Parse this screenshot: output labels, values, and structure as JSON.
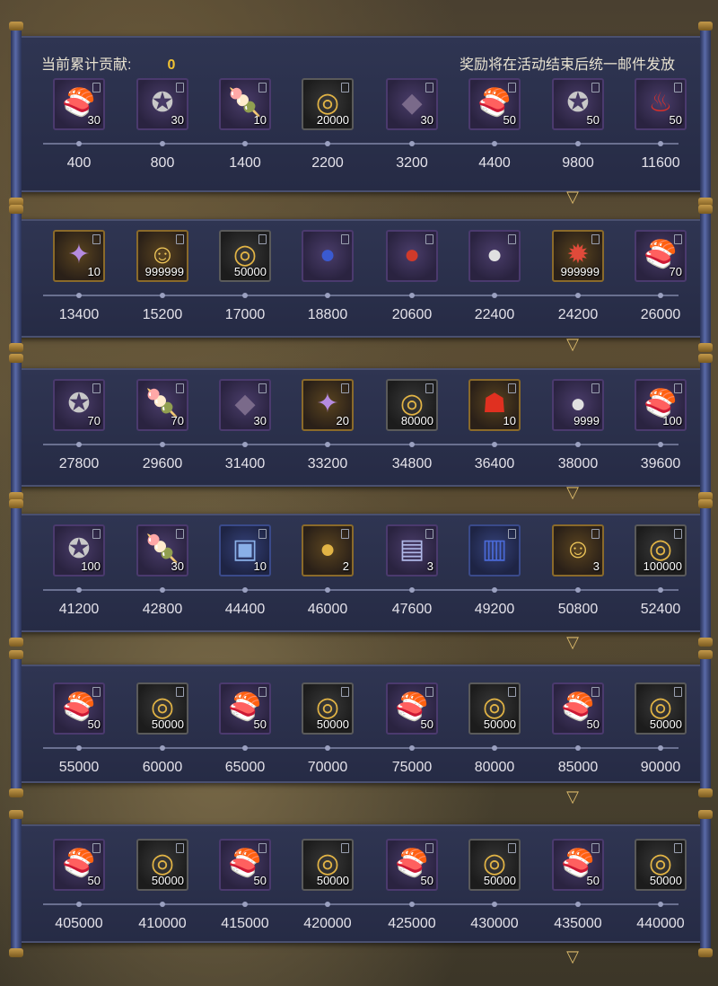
{
  "header": {
    "contribution_label": "当前累计贡献:",
    "contribution_value": "0",
    "mail_notice": "奖励将在活动结束后统一邮件发放"
  },
  "tiers": [
    {
      "rewards": [
        {
          "icon": "sushi-icon",
          "qty": "30",
          "threshold": "400"
        },
        {
          "icon": "coin-star-icon",
          "qty": "30",
          "threshold": "800"
        },
        {
          "icon": "mochi-icon",
          "qty": "10",
          "threshold": "1400"
        },
        {
          "icon": "gold-ring-icon",
          "qty": "20000",
          "threshold": "2200"
        },
        {
          "icon": "dark-orb-icon",
          "qty": "30",
          "threshold": "3200"
        },
        {
          "icon": "sushi-icon",
          "qty": "50",
          "threshold": "4400"
        },
        {
          "icon": "coin-star-icon",
          "qty": "50",
          "threshold": "9800"
        },
        {
          "icon": "red-flame-icon",
          "qty": "50",
          "threshold": "11600"
        }
      ]
    },
    {
      "rewards": [
        {
          "icon": "purple-scroll-icon",
          "qty": "10",
          "threshold": "13400"
        },
        {
          "icon": "character-card-icon",
          "qty": "999999",
          "threshold": "15200"
        },
        {
          "icon": "gold-ring-icon",
          "qty": "50000",
          "threshold": "17000"
        },
        {
          "icon": "blue-daruma-icon",
          "qty": "",
          "threshold": "18800"
        },
        {
          "icon": "red-daruma-icon",
          "qty": "",
          "threshold": "20600"
        },
        {
          "icon": "white-daruma-icon",
          "qty": "",
          "threshold": "22400"
        },
        {
          "icon": "red-creature-icon",
          "qty": "999999",
          "threshold": "24200"
        },
        {
          "icon": "sushi-icon",
          "qty": "70",
          "threshold": "26000"
        }
      ]
    },
    {
      "rewards": [
        {
          "icon": "coin-star-icon",
          "qty": "70",
          "threshold": "27800"
        },
        {
          "icon": "mochi-icon",
          "qty": "70",
          "threshold": "29600"
        },
        {
          "icon": "dark-orb-icon",
          "qty": "30",
          "threshold": "31400"
        },
        {
          "icon": "purple-scroll-icon",
          "qty": "20",
          "threshold": "33200"
        },
        {
          "icon": "gold-ring-icon",
          "qty": "80000",
          "threshold": "34800"
        },
        {
          "icon": "red-mask-icon",
          "qty": "10",
          "threshold": "36400"
        },
        {
          "icon": "white-daruma-icon",
          "qty": "9999",
          "threshold": "38000"
        },
        {
          "icon": "sushi-icon",
          "qty": "100",
          "threshold": "39600"
        }
      ]
    },
    {
      "rewards": [
        {
          "icon": "coin-star-icon",
          "qty": "100",
          "threshold": "41200"
        },
        {
          "icon": "mochi-icon",
          "qty": "30",
          "threshold": "42800"
        },
        {
          "icon": "amulet-icon",
          "qty": "10",
          "threshold": "44400"
        },
        {
          "icon": "gold-daruma-icon",
          "qty": "2",
          "threshold": "46000"
        },
        {
          "icon": "ticket-icon",
          "qty": "3",
          "threshold": "47600"
        },
        {
          "icon": "blue-ticket-icon",
          "qty": "",
          "threshold": "49200"
        },
        {
          "icon": "character-card-icon",
          "qty": "3",
          "threshold": "50800"
        },
        {
          "icon": "gold-ring-icon",
          "qty": "100000",
          "threshold": "52400"
        }
      ]
    },
    {
      "rewards": [
        {
          "icon": "sushi-icon",
          "qty": "50",
          "threshold": "55000"
        },
        {
          "icon": "gold-ring-icon",
          "qty": "50000",
          "threshold": "60000"
        },
        {
          "icon": "sushi-icon",
          "qty": "50",
          "threshold": "65000"
        },
        {
          "icon": "gold-ring-icon",
          "qty": "50000",
          "threshold": "70000"
        },
        {
          "icon": "sushi-icon",
          "qty": "50",
          "threshold": "75000"
        },
        {
          "icon": "gold-ring-icon",
          "qty": "50000",
          "threshold": "80000"
        },
        {
          "icon": "sushi-icon",
          "qty": "50",
          "threshold": "85000"
        },
        {
          "icon": "gold-ring-icon",
          "qty": "50000",
          "threshold": "90000"
        }
      ]
    },
    {
      "rewards": [
        {
          "icon": "sushi-icon",
          "qty": "50",
          "threshold": "405000"
        },
        {
          "icon": "gold-ring-icon",
          "qty": "50000",
          "threshold": "410000"
        },
        {
          "icon": "sushi-icon",
          "qty": "50",
          "threshold": "415000"
        },
        {
          "icon": "gold-ring-icon",
          "qty": "50000",
          "threshold": "420000"
        },
        {
          "icon": "sushi-icon",
          "qty": "50",
          "threshold": "425000"
        },
        {
          "icon": "gold-ring-icon",
          "qty": "50000",
          "threshold": "430000"
        },
        {
          "icon": "sushi-icon",
          "qty": "50",
          "threshold": "435000"
        },
        {
          "icon": "gold-ring-icon",
          "qty": "50000",
          "threshold": "440000"
        }
      ]
    }
  ]
}
